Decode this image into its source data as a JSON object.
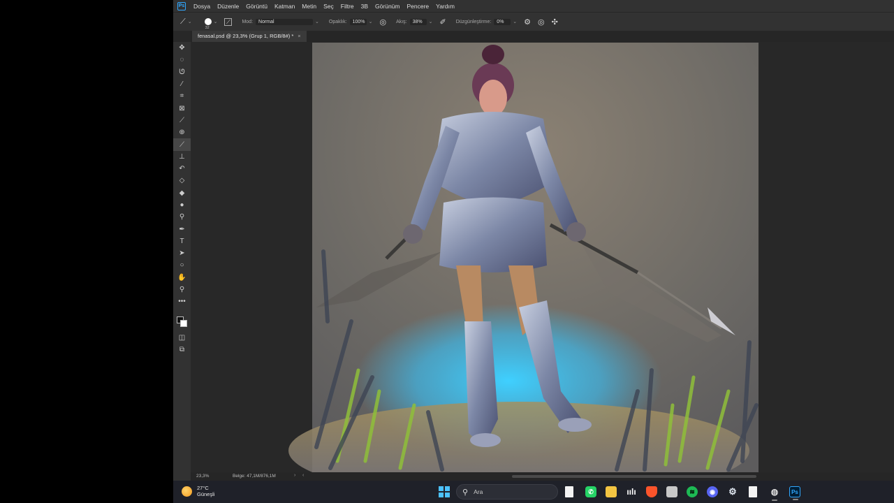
{
  "app": {
    "logo_text": "Ps"
  },
  "menubar": {
    "items": [
      "Dosya",
      "Düzenle",
      "Görüntü",
      "Katman",
      "Metin",
      "Seç",
      "Filtre",
      "3B",
      "Görünüm",
      "Pencere",
      "Yardım"
    ]
  },
  "options": {
    "brush_size": "32",
    "mode_label": "Mod:",
    "mode_value": "Normal",
    "opacity_label": "Opaklık:",
    "opacity_value": "100%",
    "flow_label": "Akış:",
    "flow_value": "38%",
    "smoothing_label": "Düzgünleştirme:",
    "smoothing_value": "0%"
  },
  "toolbar": {
    "tools": [
      {
        "name": "move-tool-icon",
        "glyph": "✥"
      },
      {
        "name": "elliptical-marquee-icon",
        "glyph": "◌"
      },
      {
        "name": "lasso-icon",
        "glyph": "ᘎ"
      },
      {
        "name": "magic-wand-icon",
        "glyph": "⁄"
      },
      {
        "name": "crop-icon",
        "glyph": "⌗"
      },
      {
        "name": "frame-icon",
        "glyph": "⊠"
      },
      {
        "name": "eyedropper-icon",
        "glyph": "⟋"
      },
      {
        "name": "healing-brush-icon",
        "glyph": "⊕"
      },
      {
        "name": "brush-icon",
        "glyph": "⟋",
        "active": true
      },
      {
        "name": "clone-stamp-icon",
        "glyph": "⊥"
      },
      {
        "name": "history-brush-icon",
        "glyph": "↶"
      },
      {
        "name": "eraser-icon",
        "glyph": "◇"
      },
      {
        "name": "paint-bucket-icon",
        "glyph": "◆"
      },
      {
        "name": "blur-icon",
        "glyph": "●"
      },
      {
        "name": "dodge-icon",
        "glyph": "⚲"
      },
      {
        "name": "pen-icon",
        "glyph": "✒"
      },
      {
        "name": "type-icon",
        "glyph": "T"
      },
      {
        "name": "path-selection-icon",
        "glyph": "➤"
      },
      {
        "name": "ellipse-tool-icon",
        "glyph": "○"
      },
      {
        "name": "hand-icon",
        "glyph": "✋"
      },
      {
        "name": "zoom-icon",
        "glyph": "⚲"
      },
      {
        "name": "more-tools-icon",
        "glyph": "•••"
      }
    ]
  },
  "document": {
    "tab_title": "fenasal.psd @ 23,3% (Grup 1, RGB/8#) *",
    "close_glyph": "×"
  },
  "statusbar": {
    "zoom": "23,3%",
    "doc_info": "Belge: 47,1M/876,1M"
  },
  "taskbar": {
    "weather_temp": "27°C",
    "weather_desc": "Güneşli",
    "search_placeholder": "Ara"
  },
  "colors": {
    "accent": "#31a8ff",
    "windows_blue": "#4cc2ff",
    "whatsapp": "#25d366",
    "spotify": "#1db954",
    "discord": "#5865f2",
    "brave": "#fb542b"
  }
}
